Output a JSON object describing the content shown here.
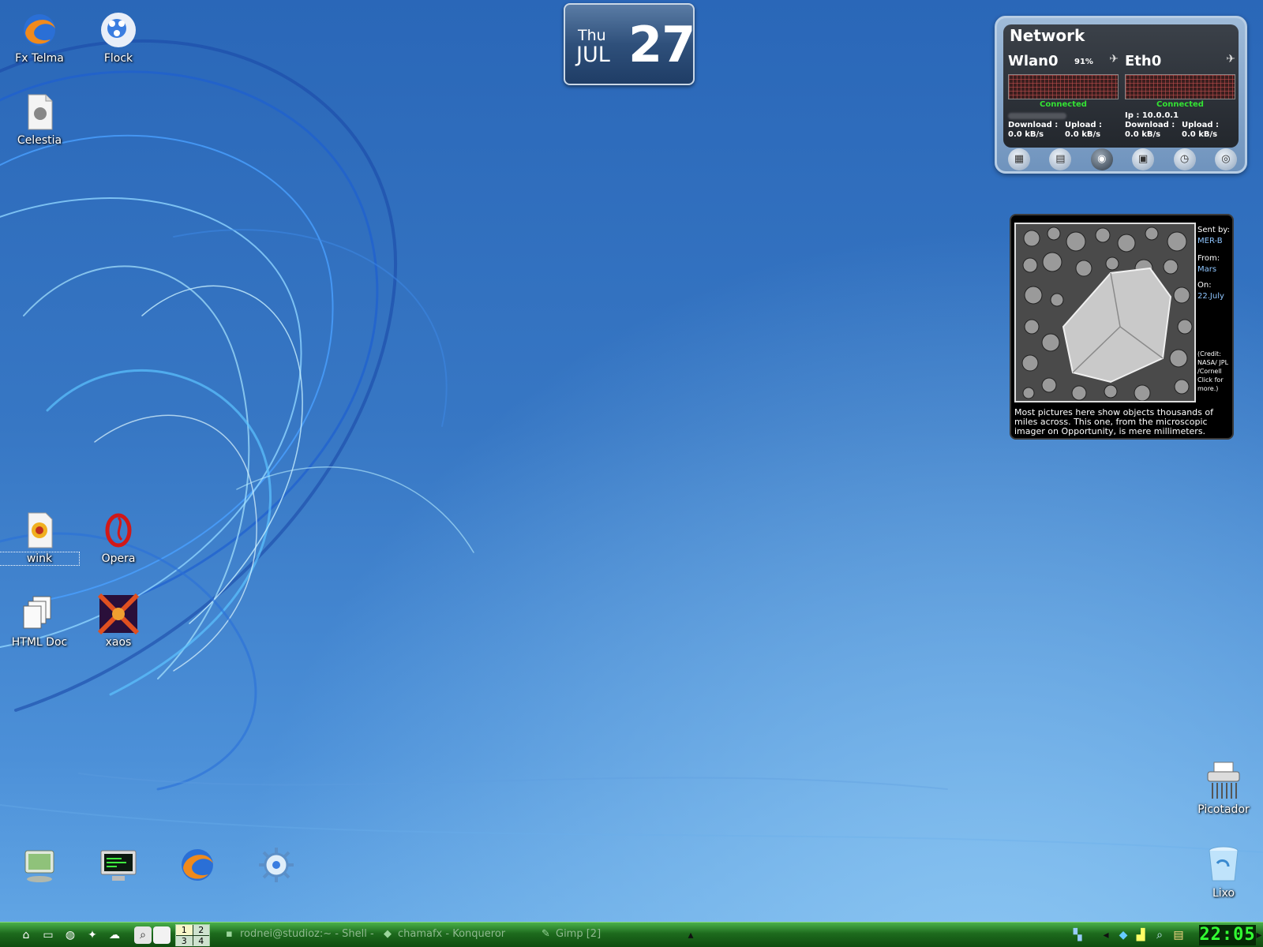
{
  "desktop": {
    "icons": [
      {
        "label": "Fx Telma",
        "icon": "firefox-icon"
      },
      {
        "label": "Flock",
        "icon": "flock-icon"
      },
      {
        "label": "Celestia",
        "icon": "celestia-icon"
      },
      {
        "label": "wink",
        "icon": "wink-icon"
      },
      {
        "label": "Opera",
        "icon": "opera-icon"
      },
      {
        "label": "HTML Doc",
        "icon": "html-doc-icon"
      },
      {
        "label": "xaos",
        "icon": "xaos-icon"
      },
      {
        "label": "Picotador",
        "icon": "shredder-icon"
      },
      {
        "label": "Lixo",
        "icon": "trash-icon"
      }
    ],
    "launchers": [
      "system-icon",
      "terminal-icon",
      "firefox-icon",
      "konqueror-icon"
    ]
  },
  "date_widget": {
    "weekday": "Thu",
    "month": "JUL",
    "day": "27"
  },
  "network": {
    "title": "Network",
    "wlan": {
      "name": "Wlan0",
      "signal": "91%",
      "status": "Connected",
      "download_label": "Download :",
      "download": "0.0 kB/s",
      "upload_label": "Upload :",
      "upload": "0.0 kB/s"
    },
    "eth": {
      "name": "Eth0",
      "status": "Connected",
      "ip": "Ip : 10.0.0.1",
      "download_label": "Download :",
      "download": "0.0 kB/s",
      "upload_label": "Upload :",
      "upload": "0.0 kB/s"
    },
    "iconbar": [
      "memory-icon",
      "disk-icon",
      "network-icon",
      "cpu-icon",
      "clock-icon",
      "cd-icon"
    ]
  },
  "apod": {
    "sent_by_label": "Sent by:",
    "sent_by": "MER-B",
    "from_label": "From:",
    "from": "Mars",
    "on_label": "On:",
    "on": "22.July",
    "credit": "(Credit: NASA/ JPL /Cornell Click for more.)",
    "caption": "Most pictures here show objects thousands of miles across. This one, from the microscopic imager on Opportunity, is mere millimeters."
  },
  "taskbar": {
    "quick_launch": [
      "home-icon",
      "folder-icon",
      "browser-icon",
      "kde-icon",
      "flock-icon",
      "search-icon",
      "blank-icon"
    ],
    "pager": [
      "1",
      "2",
      "3",
      "4"
    ],
    "tasks": [
      {
        "label": "rodnei@studioz:~ - Shell - ",
        "icon": "terminal-icon"
      },
      {
        "label": "chamafx - Konqueror",
        "icon": "konqueror-icon"
      },
      {
        "label": "Gimp [2]",
        "icon": "gimp-icon"
      }
    ],
    "clock": "22:05",
    "colors": {
      "accent": "#1d6a1d",
      "clock_text": "#33ff33"
    }
  }
}
